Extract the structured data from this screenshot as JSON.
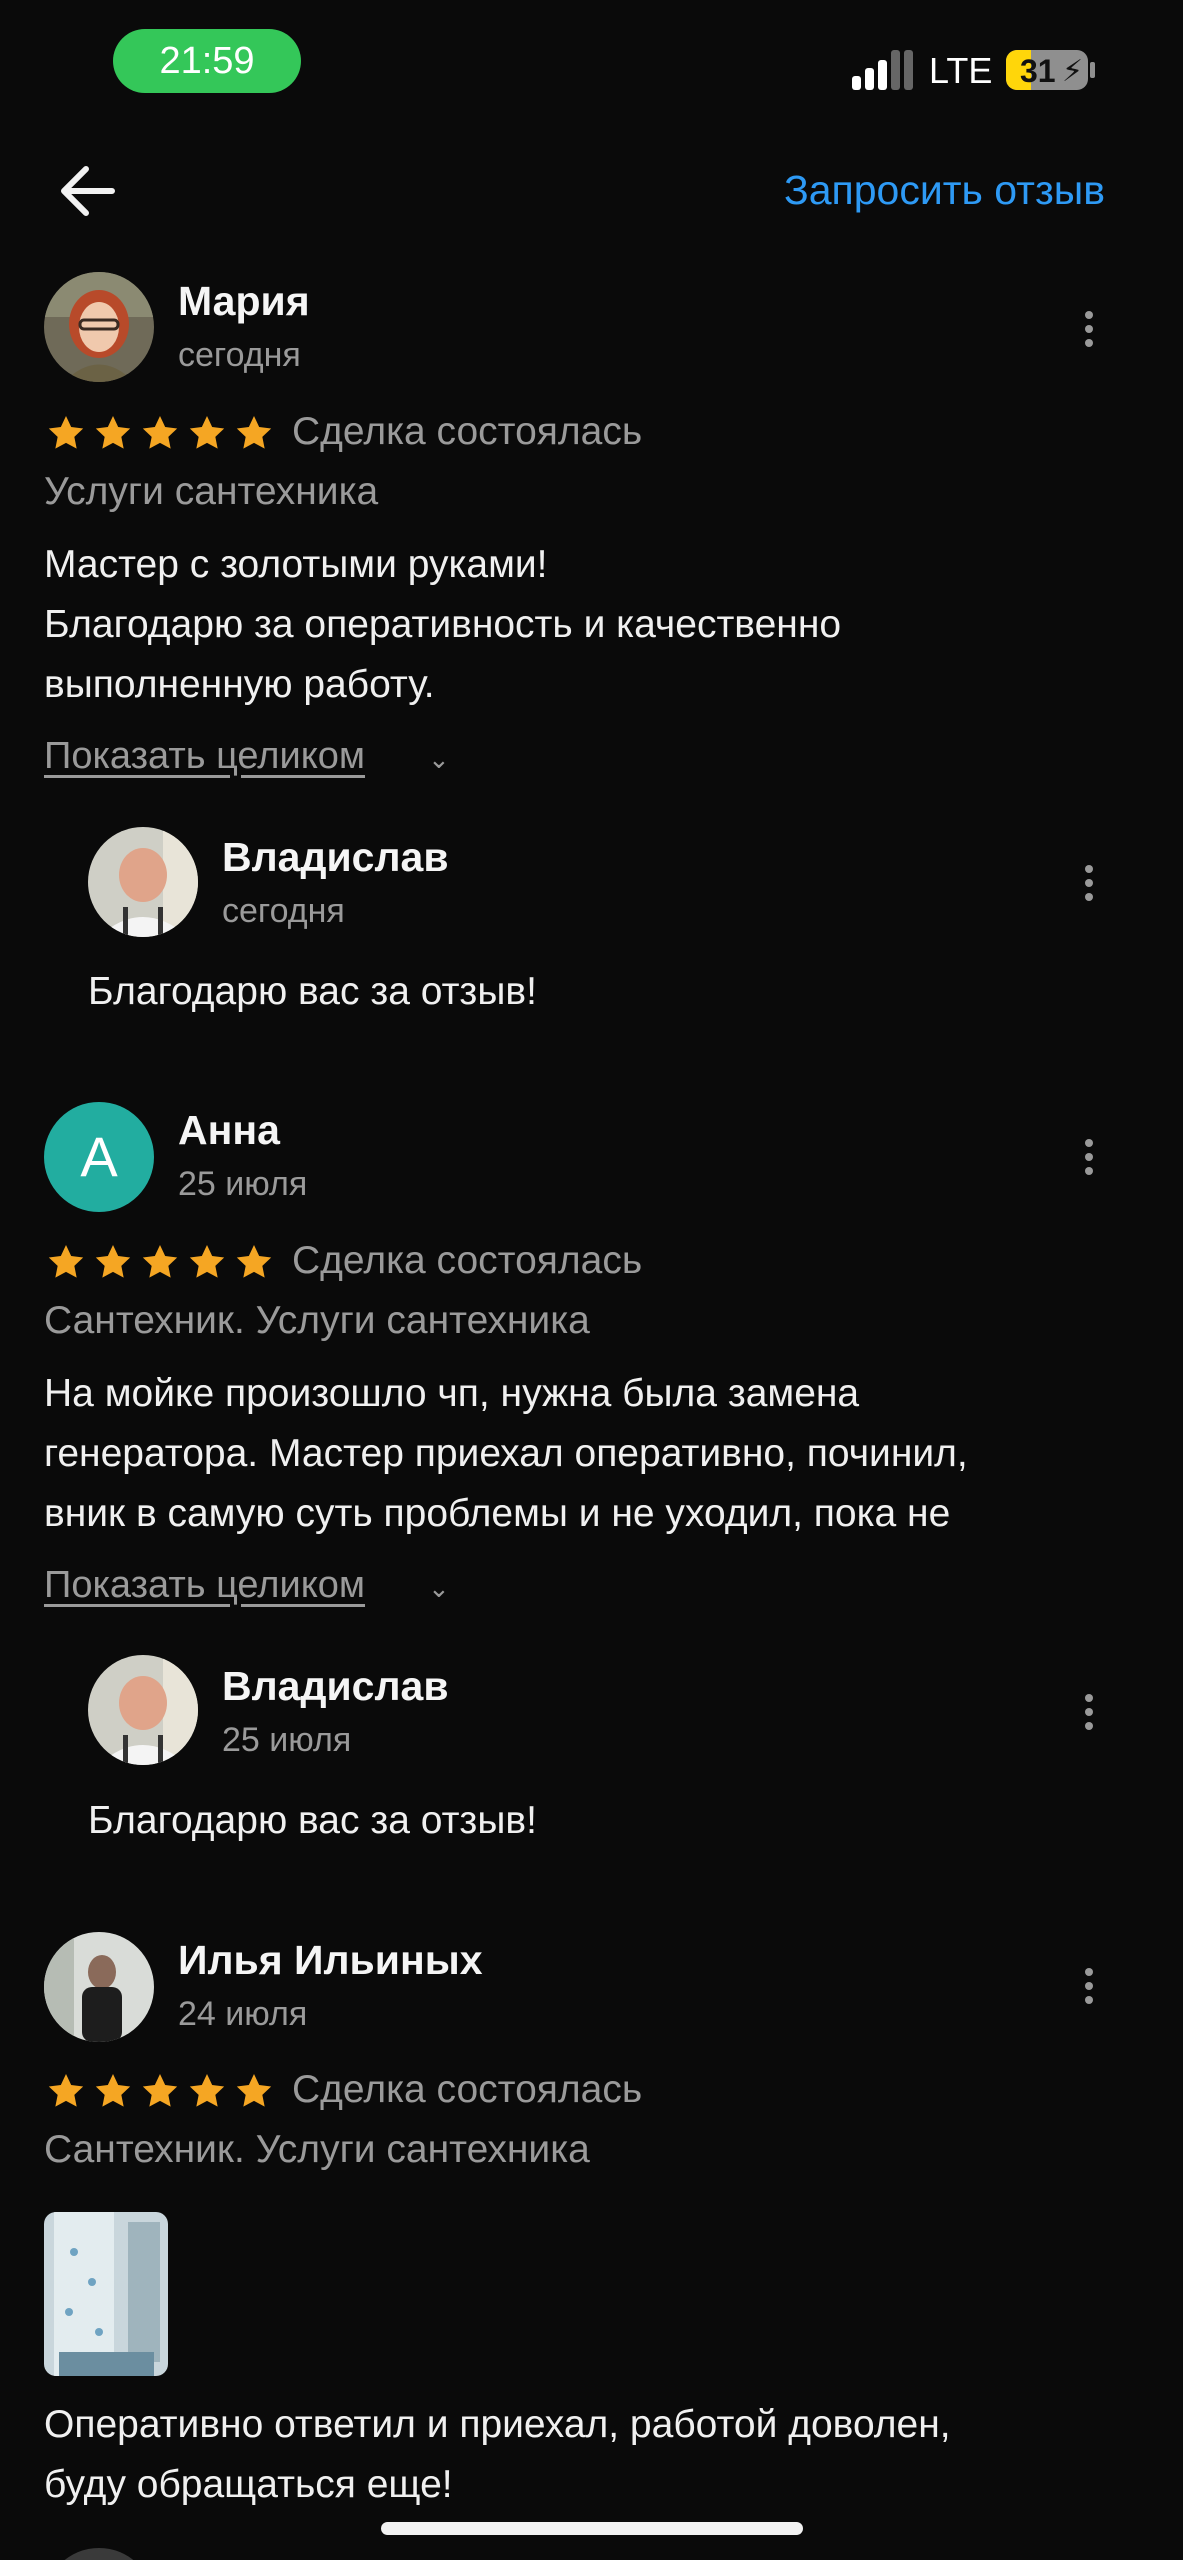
{
  "status_bar": {
    "time": "21:59",
    "network": "LTE",
    "battery": "31",
    "battery_level": 0.31
  },
  "header": {
    "request_label": "Запросить отзыв"
  },
  "reviews": [
    {
      "author": "Мария",
      "date": "сегодня",
      "rating": 5,
      "deal_status": "Сделка состоялась",
      "service": "Услуги сантехника",
      "text_lines": [
        "Мастер с золотыми руками!",
        "Благодарю за оперативность и качественно",
        "выполненную работу."
      ],
      "show_all": "Показать целиком",
      "reply": {
        "author": "Владислав",
        "date": "сегодня",
        "text": "Благодарю вас за отзыв!"
      }
    },
    {
      "author": "Анна",
      "avatar_letter": "А",
      "avatar_color": "#22ada0",
      "date": "25 июля",
      "rating": 5,
      "deal_status": "Сделка состоялась",
      "service": "Сантехник. Услуги сантехника",
      "text_lines": [
        "На мойке произошло чп, нужна была замена",
        "генератора. Мастер приехал оперативно, починил,",
        "вник в самую суть проблемы и не уходил, пока не"
      ],
      "show_all": "Показать целиком",
      "reply": {
        "author": "Владислав",
        "date": "25 июля",
        "text": "Благодарю вас за отзыв!"
      }
    },
    {
      "author": "Илья Ильиных",
      "date": "24 июля",
      "rating": 5,
      "deal_status": "Сделка состоялась",
      "service": "Сантехник. Услуги сантехника",
      "text_lines": [
        "Оперативно ответил и приехал, работой доволен,",
        "буду обращаться еще!"
      ]
    }
  ],
  "colors": {
    "accent": "#2e9af5",
    "star": "#f5a623",
    "background": "#0a0a0a",
    "muted": "#9a9a9a"
  },
  "icons": [
    "back-arrow-icon",
    "more-vertical-icon",
    "star-icon"
  ]
}
